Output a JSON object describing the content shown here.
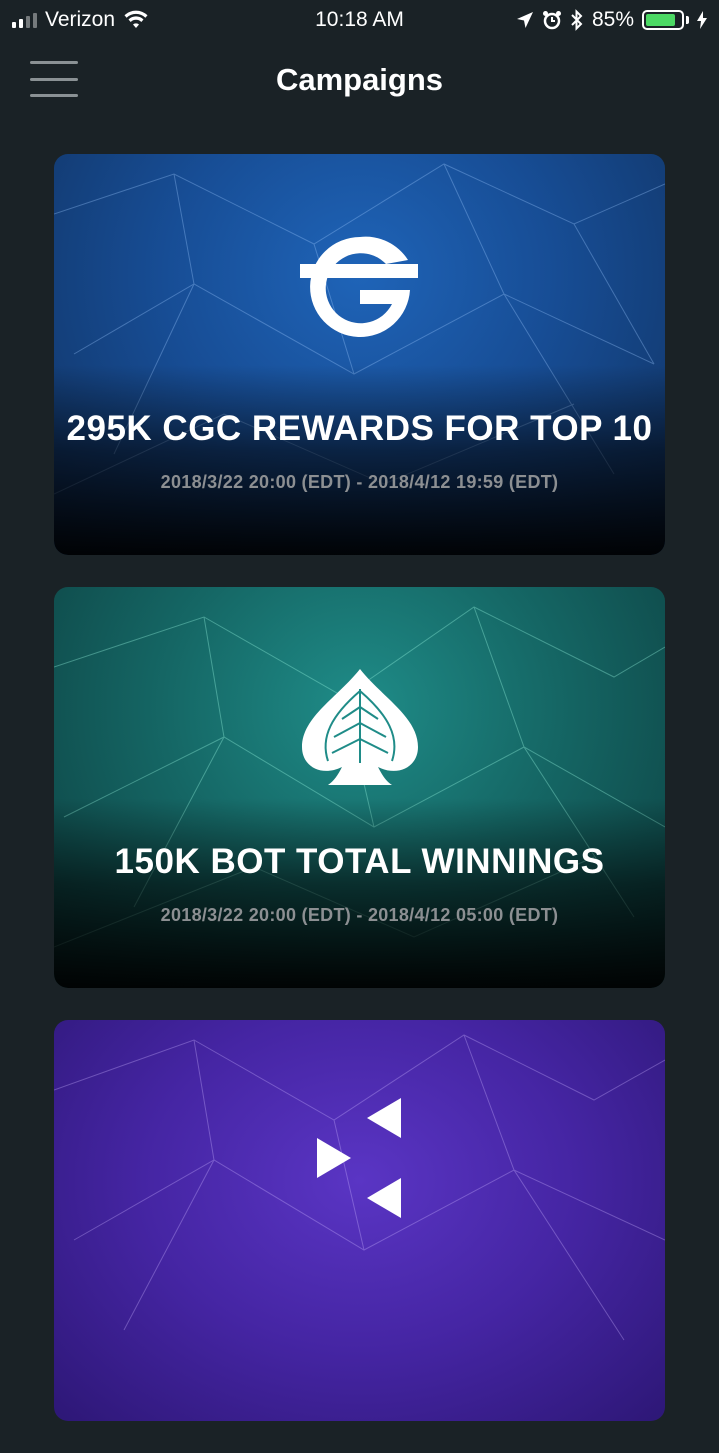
{
  "status_bar": {
    "carrier": "Verizon",
    "time": "10:18 AM",
    "battery_percent": "85%",
    "battery_level": 0.85,
    "icons": [
      "signal-icon",
      "wifi-icon",
      "location-arrow-icon",
      "alarm-icon",
      "bluetooth-icon",
      "battery-icon",
      "charging-bolt-icon"
    ]
  },
  "header": {
    "title": "Campaigns",
    "menu_icon": "hamburger-menu-icon"
  },
  "campaigns": [
    {
      "title": "295K CGC REWARDS FOR TOP 10",
      "dates": "2018/3/22 20:00 (EDT) - 2018/4/12 19:59 (EDT)",
      "logo": "cgc-g-logo",
      "accent": "#1f64b8"
    },
    {
      "title": "150K BOT TOTAL WINNINGS",
      "dates": "2018/3/22 20:00 (EDT) - 2018/4/12 05:00 (EDT)",
      "logo": "spade-leaf-logo",
      "accent": "#1f8c88"
    },
    {
      "title": "",
      "dates": "",
      "logo": "triangles-logo",
      "accent": "#5a35c4"
    }
  ]
}
